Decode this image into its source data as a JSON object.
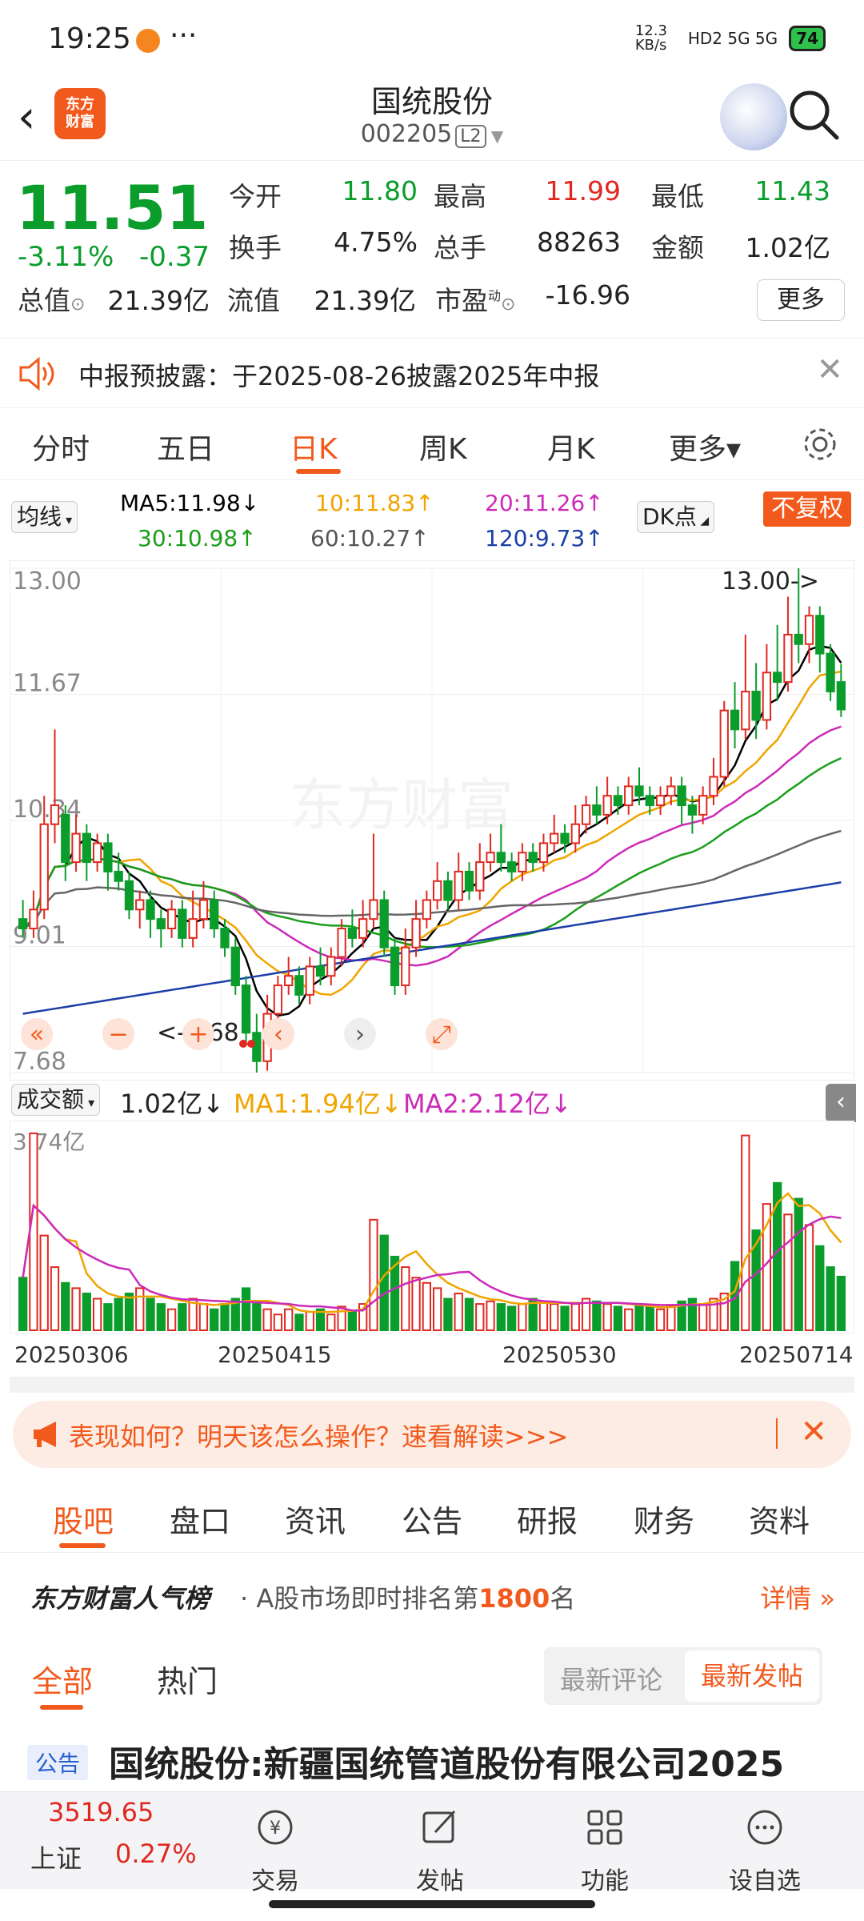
{
  "status_bar": {
    "time": "19:25",
    "speed": "12.3 KB/s",
    "network": "HD2 5G 5G",
    "battery": "74"
  },
  "header": {
    "title": "国统股份",
    "code": "002205",
    "level": "L2",
    "logo_line1": "东方",
    "logo_line2": "财富"
  },
  "quote": {
    "price": "11.51",
    "change_pct": "-3.11%",
    "change": "-0.37",
    "rows": [
      [
        {
          "label": "今开",
          "value": "11.80",
          "color": "#0a9d2c"
        },
        {
          "label": "最高",
          "value": "11.99",
          "color": "#e0281f"
        },
        {
          "label": "最低",
          "value": "11.43",
          "color": "#0a9d2c"
        }
      ],
      [
        {
          "label": "换手",
          "value": "4.75%",
          "color": "#222222"
        },
        {
          "label": "总手",
          "value": "88263",
          "color": "#222222"
        },
        {
          "label": "金额",
          "value": "1.02亿",
          "color": "#222222"
        }
      ]
    ],
    "total_value_label": "总值",
    "total_value": "21.39亿",
    "float_value_label": "流值",
    "float_value": "21.39亿",
    "pe_label": "市盈",
    "pe_sup": "动",
    "pe_value": "-16.96",
    "more": "更多"
  },
  "notice": {
    "text": "中报预披露：于2025-08-26披露2025年中报"
  },
  "period_tabs": [
    "分时",
    "五日",
    "日K",
    "周K",
    "月K",
    "更多▾"
  ],
  "active_period": "日K",
  "ma": {
    "selector": "均线",
    "ma5": "MA5:11.98",
    "ma10": "10:11.83",
    "ma20": "20:11.26",
    "ma30": "30:10.98",
    "ma60": "60:10.27",
    "ma120": "120:9.73",
    "dk": "DK点",
    "adjust": "不复权",
    "colors": {
      "ma5": "#000000",
      "ma10": "#f0a400",
      "ma20": "#cc2ab8",
      "ma30": "#1a9e1a",
      "ma60": "#666666",
      "ma120": "#1b3ea8"
    }
  },
  "kline": {
    "yticks": [
      "13.00",
      "11.67",
      "10.34",
      "9.01",
      "7.68"
    ],
    "high_label": "13.00->",
    "low_label": "<-7.68",
    "watermark": "东方财富"
  },
  "volume": {
    "selector": "成交额",
    "value": "1.02亿",
    "ma1": "MA1:1.94亿",
    "ma2": "MA2:2.12亿",
    "max": "3.74亿",
    "dates": [
      "20250306",
      "20250415",
      "20250530",
      "20250714"
    ]
  },
  "promo": {
    "text": "表现如何？明天该怎么操作？速看解读>>>"
  },
  "bottom_tabs": [
    "股吧",
    "盘口",
    "资讯",
    "公告",
    "研报",
    "财务",
    "资料"
  ],
  "rank": {
    "brand": "东方财富人气榜",
    "text": "A股市场即时排名第",
    "rank": "1800",
    "suffix": "名",
    "detail": "详情"
  },
  "feed": {
    "tabs": [
      "全部",
      "热门"
    ],
    "sort": [
      "最新评论",
      "最新发帖"
    ]
  },
  "post": {
    "tag": "公告",
    "title": "国统股份:新疆国统管道股份有限公司2025"
  },
  "index": {
    "value": "3519.65",
    "name": "上证",
    "pct": "0.27%"
  },
  "nav": [
    "交易",
    "发帖",
    "功能",
    "设自选"
  ],
  "chart_data": {
    "type": "candlestick",
    "title": "",
    "ylim": [
      7.68,
      13.0
    ],
    "x_dates": [
      "20250306",
      "20250415",
      "20250530",
      "20250714"
    ],
    "ma_values": {
      "MA5": 11.98,
      "MA10": 11.83,
      "MA20": 11.26,
      "MA30": 10.98,
      "MA60": 10.27,
      "MA120": 9.73
    },
    "candles": [
      [
        9.3,
        9.2,
        9.5,
        9.1
      ],
      [
        9.2,
        9.4,
        9.6,
        9.1
      ],
      [
        9.4,
        10.3,
        10.6,
        9.3
      ],
      [
        10.3,
        10.5,
        11.3,
        10.1
      ],
      [
        10.4,
        9.9,
        10.5,
        9.7
      ],
      [
        9.9,
        10.2,
        10.4,
        9.8
      ],
      [
        10.2,
        9.9,
        10.3,
        9.7
      ],
      [
        9.9,
        10.1,
        10.2,
        9.8
      ],
      [
        10.1,
        9.8,
        10.2,
        9.6
      ],
      [
        9.8,
        9.7,
        10.0,
        9.6
      ],
      [
        9.7,
        9.4,
        9.8,
        9.3
      ],
      [
        9.4,
        9.5,
        9.6,
        9.2
      ],
      [
        9.5,
        9.3,
        9.6,
        9.1
      ],
      [
        9.3,
        9.2,
        9.4,
        9.0
      ],
      [
        9.2,
        9.4,
        9.5,
        9.1
      ],
      [
        9.4,
        9.1,
        9.5,
        9.0
      ],
      [
        9.1,
        9.3,
        9.6,
        9.0
      ],
      [
        9.3,
        9.5,
        9.7,
        9.2
      ],
      [
        9.5,
        9.2,
        9.6,
        9.1
      ],
      [
        9.2,
        9.0,
        9.3,
        8.9
      ],
      [
        9.0,
        8.6,
        9.1,
        8.5
      ],
      [
        8.6,
        8.1,
        8.7,
        8.0
      ],
      [
        8.1,
        7.8,
        8.3,
        7.68
      ],
      [
        7.8,
        8.3,
        8.5,
        7.7
      ],
      [
        8.3,
        8.6,
        8.7,
        8.2
      ],
      [
        8.6,
        8.7,
        8.9,
        8.5
      ],
      [
        8.7,
        8.5,
        8.8,
        8.4
      ],
      [
        8.5,
        8.8,
        8.9,
        8.4
      ],
      [
        8.8,
        8.7,
        9.0,
        8.6
      ],
      [
        8.7,
        8.9,
        9.0,
        8.6
      ],
      [
        8.9,
        9.2,
        9.3,
        8.8
      ],
      [
        9.2,
        9.1,
        9.4,
        9.0
      ],
      [
        9.1,
        9.3,
        9.5,
        9.0
      ],
      [
        9.3,
        9.5,
        10.2,
        9.2
      ],
      [
        9.5,
        9.0,
        9.6,
        8.9
      ],
      [
        9.0,
        8.6,
        9.1,
        8.5
      ],
      [
        8.6,
        9.0,
        9.2,
        8.5
      ],
      [
        9.0,
        9.3,
        9.5,
        8.9
      ],
      [
        9.3,
        9.5,
        9.6,
        9.2
      ],
      [
        9.5,
        9.7,
        9.9,
        9.4
      ],
      [
        9.7,
        9.5,
        9.8,
        9.4
      ],
      [
        9.5,
        9.8,
        10.0,
        9.4
      ],
      [
        9.8,
        9.6,
        9.9,
        9.5
      ],
      [
        9.6,
        9.9,
        10.1,
        9.5
      ],
      [
        9.9,
        10.0,
        10.2,
        9.8
      ],
      [
        10.0,
        9.9,
        10.3,
        9.8
      ],
      [
        9.9,
        9.8,
        10.0,
        9.7
      ],
      [
        9.8,
        10.0,
        10.1,
        9.7
      ],
      [
        10.0,
        9.9,
        10.1,
        9.8
      ],
      [
        9.9,
        10.1,
        10.2,
        9.8
      ],
      [
        10.1,
        10.2,
        10.4,
        10.0
      ],
      [
        10.2,
        10.1,
        10.3,
        10.0
      ],
      [
        10.1,
        10.3,
        10.5,
        10.0
      ],
      [
        10.3,
        10.5,
        10.6,
        10.2
      ],
      [
        10.5,
        10.4,
        10.7,
        10.3
      ],
      [
        10.4,
        10.6,
        10.8,
        10.3
      ],
      [
        10.6,
        10.5,
        10.7,
        10.4
      ],
      [
        10.5,
        10.7,
        10.8,
        10.4
      ],
      [
        10.7,
        10.6,
        10.9,
        10.5
      ],
      [
        10.6,
        10.5,
        10.7,
        10.4
      ],
      [
        10.5,
        10.6,
        10.7,
        10.4
      ],
      [
        10.6,
        10.7,
        10.8,
        10.5
      ],
      [
        10.7,
        10.5,
        10.8,
        10.3
      ],
      [
        10.5,
        10.4,
        10.6,
        10.2
      ],
      [
        10.4,
        10.6,
        10.7,
        10.3
      ],
      [
        10.6,
        10.8,
        11.0,
        10.5
      ],
      [
        10.8,
        11.5,
        11.6,
        10.7
      ],
      [
        11.5,
        11.3,
        11.8,
        11.1
      ],
      [
        11.3,
        11.7,
        12.3,
        11.2
      ],
      [
        11.7,
        11.4,
        12.0,
        11.2
      ],
      [
        11.4,
        11.9,
        12.2,
        11.3
      ],
      [
        11.9,
        11.8,
        12.4,
        11.6
      ],
      [
        11.8,
        12.3,
        12.7,
        11.7
      ],
      [
        12.3,
        12.2,
        13.0,
        12.0
      ],
      [
        12.2,
        12.5,
        12.6,
        12.0
      ],
      [
        12.5,
        12.1,
        12.6,
        11.9
      ],
      [
        12.1,
        11.7,
        12.2,
        11.6
      ],
      [
        11.8,
        11.51,
        11.99,
        11.43
      ]
    ],
    "volume": [
      1.0,
      3.74,
      1.8,
      1.2,
      0.9,
      0.8,
      0.7,
      0.6,
      0.5,
      0.6,
      0.7,
      0.8,
      0.6,
      0.5,
      0.4,
      0.5,
      0.6,
      0.5,
      0.4,
      0.5,
      0.6,
      0.8,
      0.5,
      0.4,
      0.3,
      0.4,
      0.3,
      0.35,
      0.4,
      0.3,
      0.45,
      0.35,
      0.5,
      2.1,
      1.8,
      1.4,
      1.2,
      1.0,
      0.9,
      0.8,
      0.6,
      0.7,
      0.6,
      0.5,
      0.55,
      0.5,
      0.45,
      0.5,
      0.6,
      0.55,
      0.5,
      0.45,
      0.5,
      0.6,
      0.55,
      0.5,
      0.45,
      0.4,
      0.5,
      0.45,
      0.4,
      0.45,
      0.55,
      0.6,
      0.5,
      0.6,
      0.7,
      1.3,
      3.7,
      1.9,
      2.4,
      2.8,
      2.2,
      2.5,
      2.0,
      1.6,
      1.2,
      1.02
    ]
  }
}
